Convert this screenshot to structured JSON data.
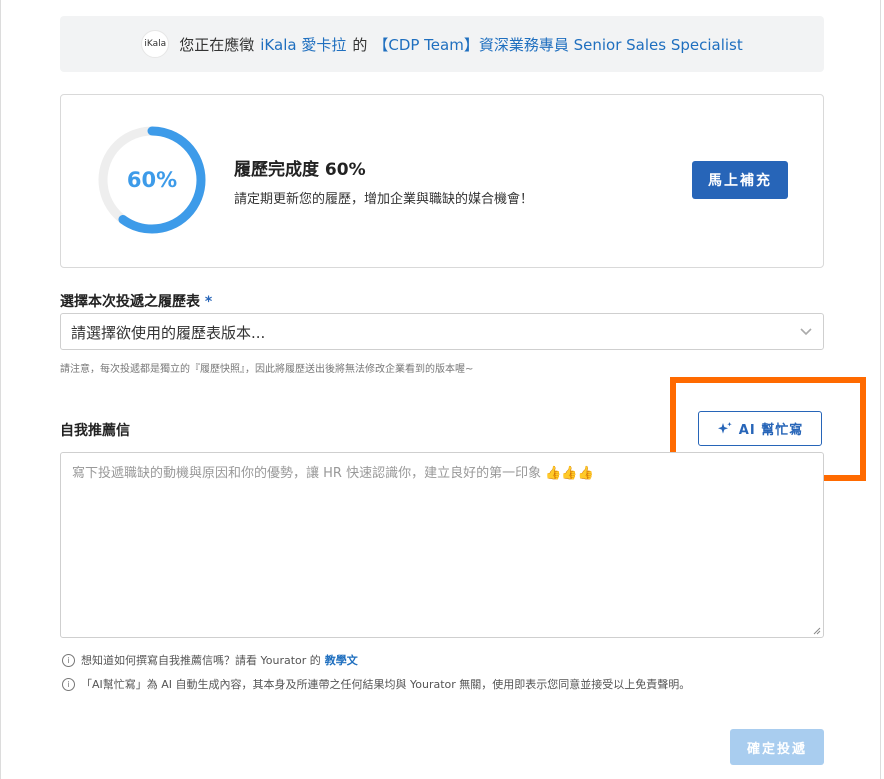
{
  "banner": {
    "logo_text": "iKala",
    "prefix": "您正在應徵",
    "company": "iKala 愛卡拉",
    "connector": "的",
    "job": "【CDP Team】資深業務專員 Senior Sales Specialist"
  },
  "completion": {
    "percent_label": "60%",
    "progress": 0.6,
    "title": "履歷完成度 60%",
    "description": "請定期更新您的履歷，增加企業與職缺的媒合機會！",
    "button_label": "馬上補充",
    "ring_color": "#3d9be9",
    "track_color": "#eeeeee"
  },
  "resume": {
    "label": "選擇本次投遞之履歷表",
    "required_mark": "*",
    "placeholder": "請選擇欲使用的履歷表版本...",
    "note": "請注意，每次投遞都是獨立的『履歷快照』，因此將履歷送出後將無法修改企業看到的版本喔~"
  },
  "letter": {
    "label": "自我推薦信",
    "ai_button_label": "AI 幫忙寫",
    "placeholder": "寫下投遞職缺的動機與原因和你的優勢，讓 HR 快速認識你，建立良好的第一印象 👍👍👍",
    "hint1_text": "想知道如何撰寫自我推薦信嗎？請看 Yourator 的",
    "hint1_link": "教學文",
    "hint2_text": "「AI幫忙寫」為 AI 自動生成內容，其本身及所連帶之任何結果均與 Yourator 無關，使用即表示您同意並接受以上免責聲明。"
  },
  "submit": {
    "label": "確定投遞"
  },
  "colors": {
    "primary": "#2765b8",
    "highlight": "#ff6a00",
    "disabled": "#a9cdef"
  }
}
